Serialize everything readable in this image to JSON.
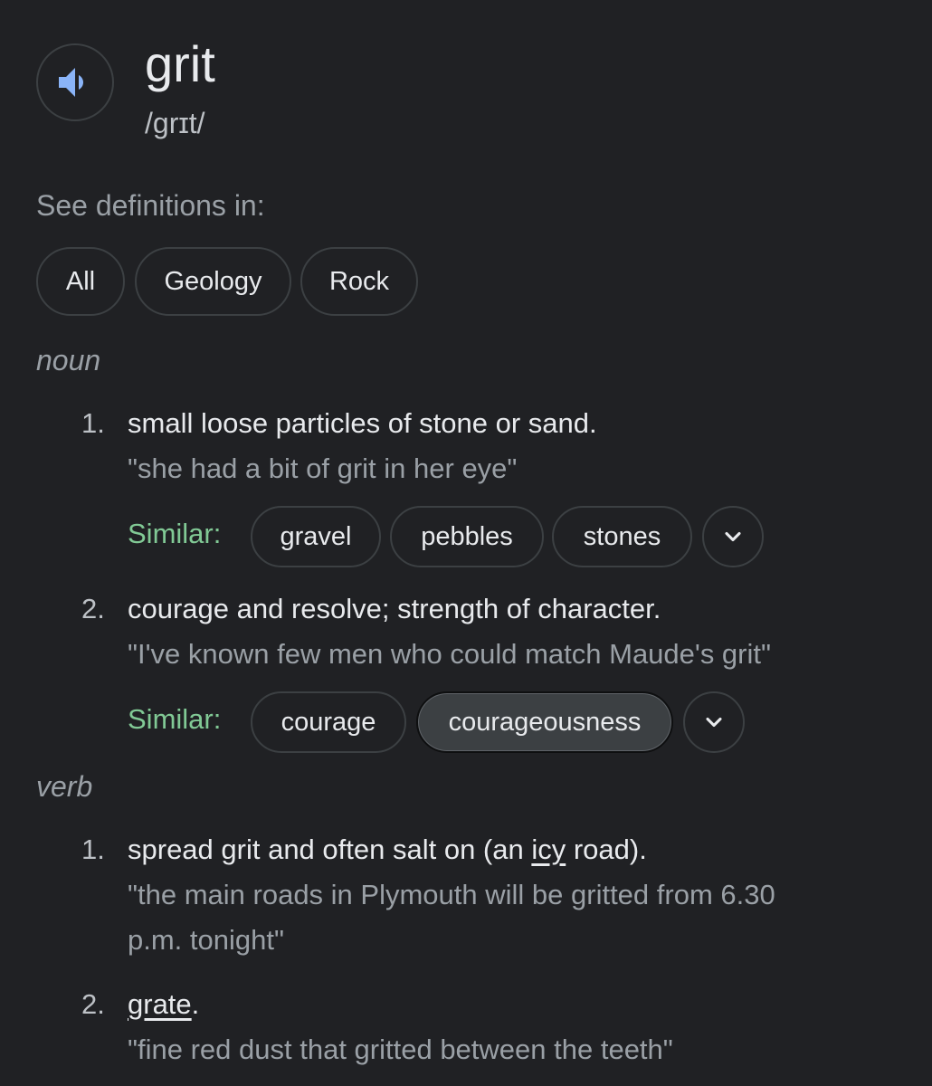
{
  "header": {
    "word": "grit",
    "phonetic": "/grɪt/",
    "audio_icon": "speaker-icon"
  },
  "see_definitions": {
    "label": "See definitions in:",
    "chips": [
      "All",
      "Geology",
      "Rock"
    ]
  },
  "noun": {
    "pos": "noun",
    "senses": [
      {
        "num": "1.",
        "definition": "small loose particles of stone or sand.",
        "example": "\"she had a bit of grit in her eye\"",
        "similar_label": "Similar:",
        "similar": [
          "gravel",
          "pebbles",
          "stones"
        ]
      },
      {
        "num": "2.",
        "definition": "courage and resolve; strength of character.",
        "example": "\"I've known few men who could match Maude's grit\"",
        "similar_label": "Similar:",
        "similar": [
          "courage",
          "courageousness"
        ]
      }
    ]
  },
  "verb": {
    "pos": "verb",
    "senses": [
      {
        "num": "1.",
        "definition_before": "spread grit and often salt on (an ",
        "definition_link": "icy",
        "definition_after": " road).",
        "example_line1": "\"the main roads in Plymouth will be gritted from 6.30",
        "example_line2": "p.m. tonight\""
      },
      {
        "num": "2.",
        "definition_link": "grate",
        "definition_after": ".",
        "example": "\"fine red dust that gritted between the teeth\""
      }
    ]
  },
  "colors": {
    "background": "#202124",
    "text_primary": "#e8eaed",
    "text_secondary": "#9aa0a6",
    "similar_green": "#81c995",
    "audio_blue": "#8ab4f8",
    "chip_border": "#3c4043"
  }
}
